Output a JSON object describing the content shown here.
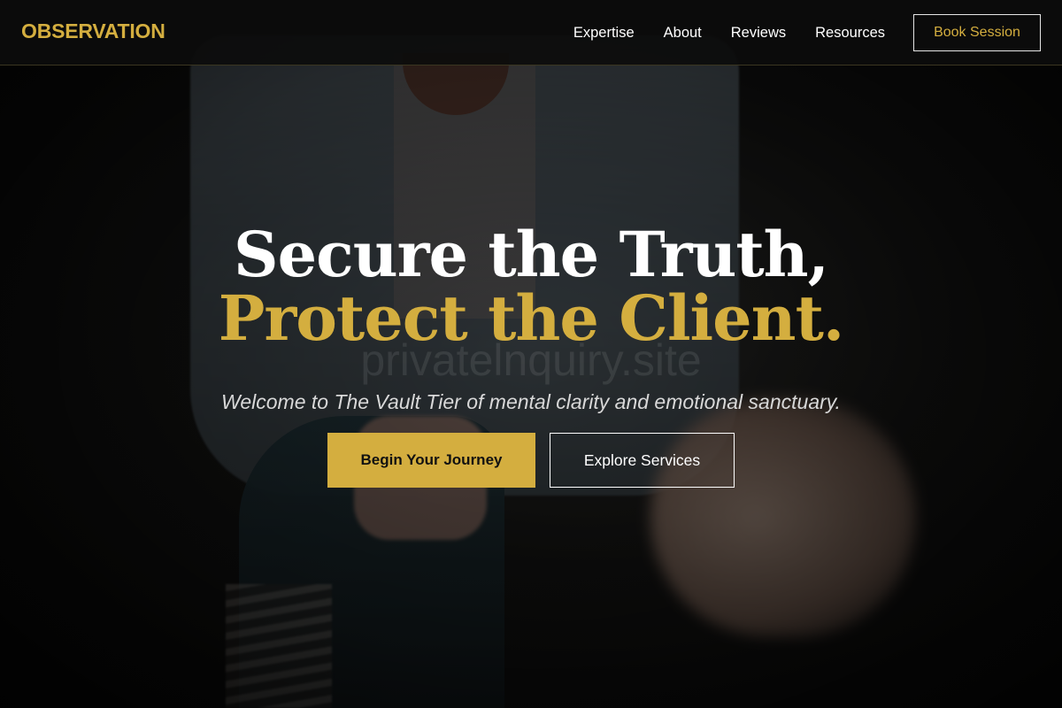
{
  "header": {
    "logo": "OBSERVATION",
    "nav": [
      {
        "label": "Expertise"
      },
      {
        "label": "About"
      },
      {
        "label": "Reviews"
      },
      {
        "label": "Resources"
      }
    ],
    "cta_label": "Book Session"
  },
  "hero": {
    "headline_line1": "Secure the Truth,",
    "headline_line2": "Protect the Client.",
    "ghost_text": "privatelnquiry.site",
    "tagline": "Welcome to The Vault Tier of mental clarity and emotional sanctuary.",
    "primary_button": "Begin Your Journey",
    "secondary_button": "Explore Services"
  },
  "colors": {
    "accent": "#d4ae3f",
    "header_bg": "#0c0c0c",
    "text_light": "#ffffff"
  }
}
